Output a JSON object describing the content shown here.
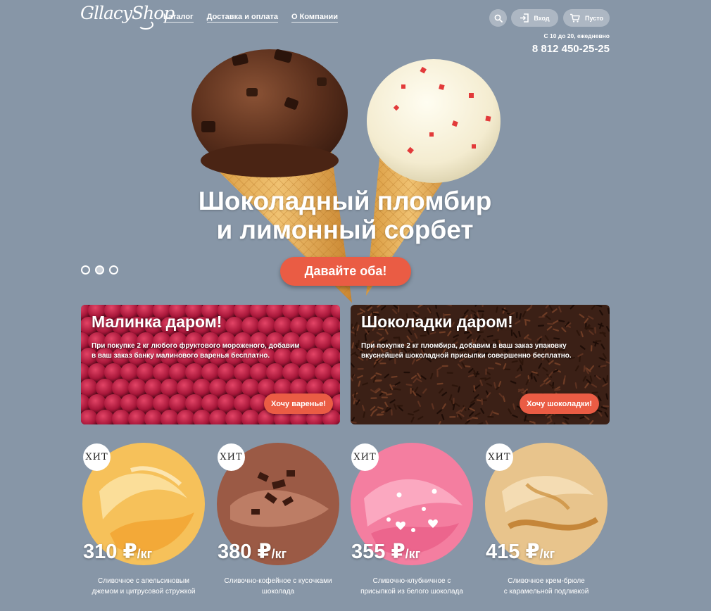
{
  "header": {
    "logo": "GllacyShop",
    "nav": [
      "Каталог",
      "Доставка и оплата",
      "О Компании"
    ],
    "login_label": "Вход",
    "cart_label": "Пусто",
    "hours": "С 10 до 20, ежедневно",
    "phone": "8 812 450-25-25"
  },
  "hero": {
    "title_line1": "Шоколадный пломбир",
    "title_line2": "и лимонный сорбет",
    "cta": "Давайте оба!",
    "slides_count": 3,
    "active_slide": 2
  },
  "promos": [
    {
      "title": "Малинка даром!",
      "text": "При покупке 2 кг любого фруктового мороженого, добавим в ваш заказ банку малинового варенья бесплатно.",
      "button": "Хочу варенье!"
    },
    {
      "title": "Шоколадки даром!",
      "text": "При покупке 2 кг пломбира, добавим в ваш заказ упаковку вкуснейшей шоколадной присыпки совершенно бесплатно.",
      "button": "Хочу шоколадки!"
    }
  ],
  "products": [
    {
      "badge": "ХИТ",
      "price": "310 ₽",
      "unit": "/кг",
      "name_line1": "Сливочное с апельсиновым",
      "name_line2": "джемом и цитрусовой стружкой",
      "color": "#f5b64a"
    },
    {
      "badge": "ХИТ",
      "price": "380 ₽",
      "unit": "/кг",
      "name_line1": "Сливочно-кофейное с кусочками",
      "name_line2": "шоколада",
      "color": "#8a4a38"
    },
    {
      "badge": "ХИТ",
      "price": "355 ₽",
      "unit": "/кг",
      "name_line1": "Сливочно-клубничное с",
      "name_line2": "присыпкой из белого шоколада",
      "color": "#f2799c"
    },
    {
      "badge": "ХИТ",
      "price": "415 ₽",
      "unit": "/кг",
      "name_line1": "Сливочное крем-брюле",
      "name_line2": "с карамельной подливкой",
      "color": "#e0b77a"
    }
  ],
  "colors": {
    "background": "#8796a7",
    "accent": "#ea5c44"
  },
  "icons": [
    "search-icon",
    "login-icon",
    "cart-icon"
  ]
}
